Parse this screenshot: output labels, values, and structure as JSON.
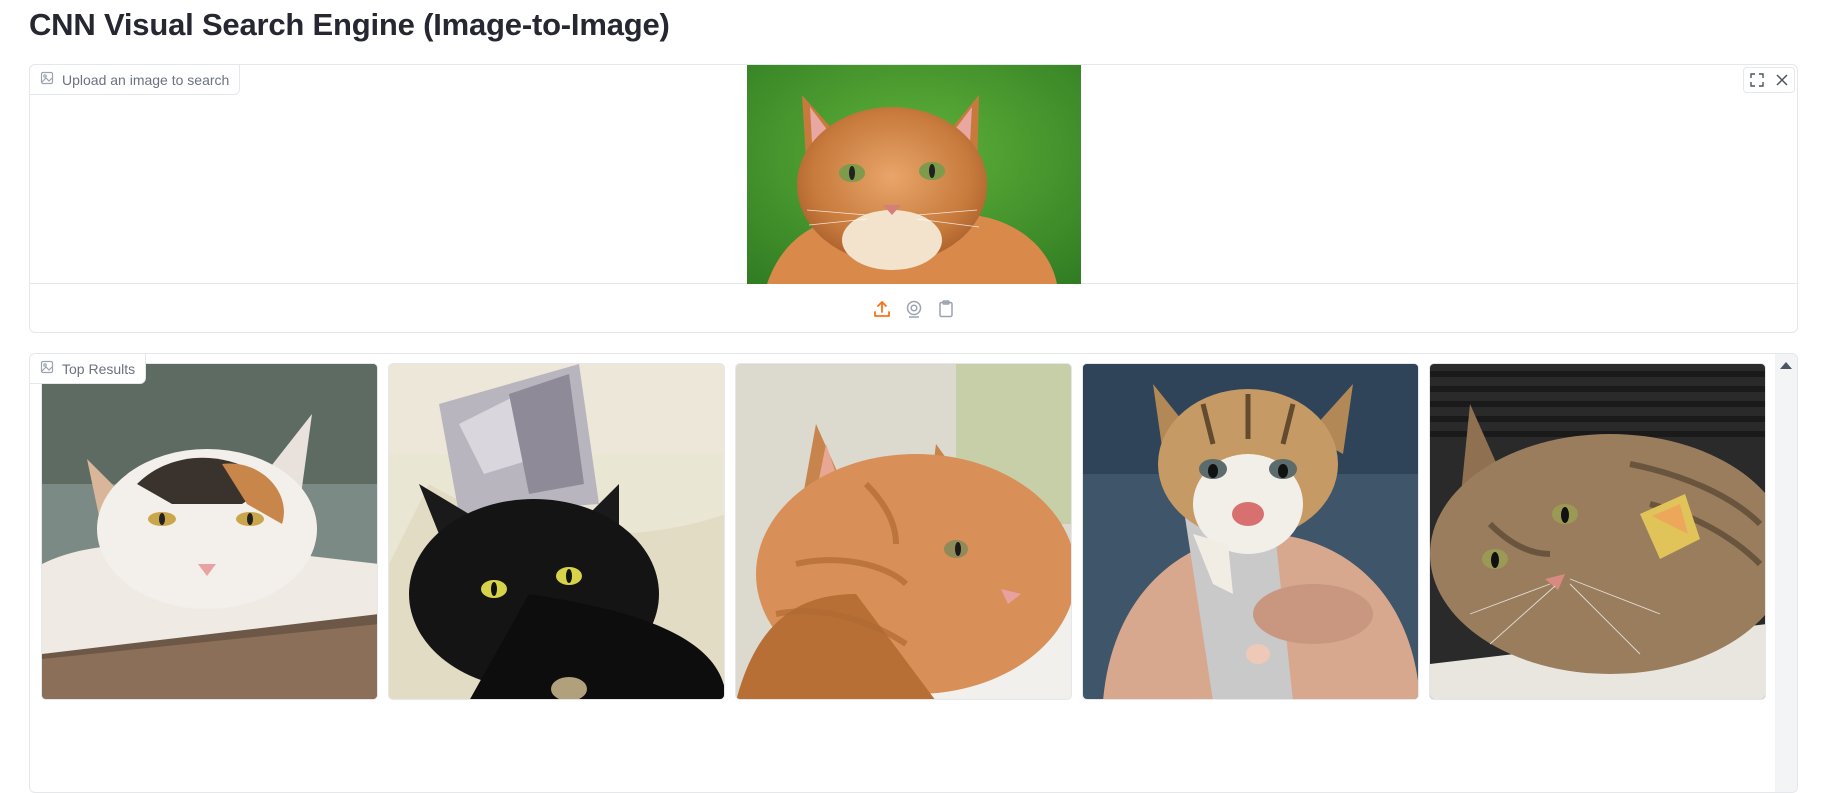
{
  "page": {
    "title": "CNN Visual Search Engine (Image-to-Image)"
  },
  "upload": {
    "label": "Upload an image to search",
    "query_image_alt": "orange tabby cat on green background",
    "tools": [
      "fullscreen-icon",
      "close-icon"
    ],
    "sources": [
      "upload-icon",
      "webcam-icon",
      "clipboard-icon"
    ],
    "accent_color": "#f97316"
  },
  "results": {
    "label": "Top Results",
    "items": [
      {
        "alt": "calico cat lying on wooden plank"
      },
      {
        "alt": "black cat wearing tin foil hat"
      },
      {
        "alt": "orange tabby cat in sink, profile"
      },
      {
        "alt": "tabby kitten held in hands"
      },
      {
        "alt": "tabby cat lying with yellow tag"
      }
    ]
  }
}
